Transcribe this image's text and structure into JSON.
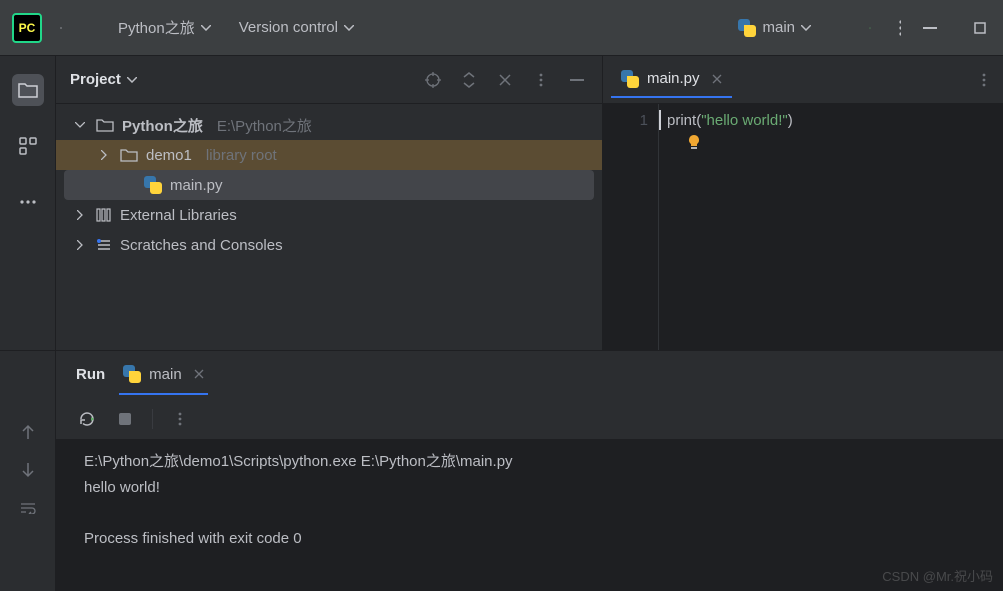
{
  "topbar": {
    "logo_text": "PC",
    "project_name": "Python之旅",
    "version_control": "Version control",
    "run_config": "main"
  },
  "project": {
    "title": "Project",
    "root_name": "Python之旅",
    "root_path": "E:\\Python之旅",
    "demo_name": "demo1",
    "demo_hint": "library root",
    "main_file": "main.py",
    "external": "External Libraries",
    "scratches": "Scratches and Consoles"
  },
  "editor": {
    "tab_name": "main.py",
    "line_no": "1",
    "code_fn": "print",
    "code_open": "(",
    "code_str": "\"hello world!\"",
    "code_close": ")"
  },
  "run": {
    "title": "Run",
    "tab": "main",
    "line1": "E:\\Python之旅\\demo1\\Scripts\\python.exe E:\\Python之旅\\main.py",
    "line2": "hello world!",
    "line3": "Process finished with exit code 0"
  },
  "watermark": "CSDN @Mr.祝小码"
}
